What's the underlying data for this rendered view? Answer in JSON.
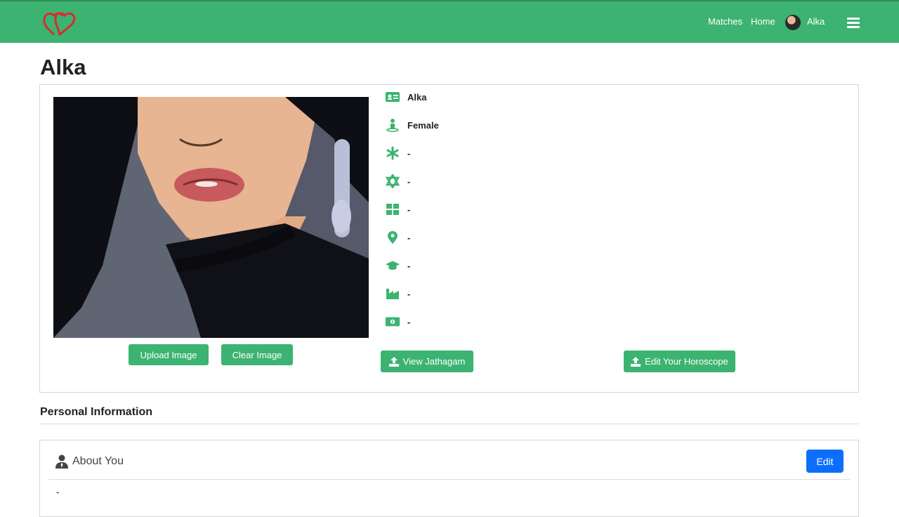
{
  "nav": {
    "links": [
      "Matches",
      "Home"
    ],
    "user_name": "Alka"
  },
  "profile": {
    "title": "Alka",
    "fields": [
      {
        "icon": "id-card-icon",
        "value": "Alka"
      },
      {
        "icon": "person-icon",
        "value": "Female"
      },
      {
        "icon": "asterisk-icon",
        "value": "-"
      },
      {
        "icon": "star-of-david-icon",
        "value": "-"
      },
      {
        "icon": "grid-icon",
        "value": "-"
      },
      {
        "icon": "map-pin-icon",
        "value": "-"
      },
      {
        "icon": "graduation-cap-icon",
        "value": "-"
      },
      {
        "icon": "industry-icon",
        "value": "-"
      },
      {
        "icon": "money-bill-icon",
        "value": "-"
      }
    ],
    "buttons": {
      "upload": "Upload Image",
      "clear": "Clear Image",
      "view_jathagam": "View Jathagam",
      "edit_horoscope": "Edit Your Horoscope"
    }
  },
  "personal": {
    "heading": "Personal Information",
    "about_title": "About You",
    "edit_label": "Edit",
    "about_value": "-"
  },
  "colors": {
    "brand_green": "#3cb371",
    "edit_blue": "#0d6efd",
    "logo_red": "#d62d2d"
  }
}
